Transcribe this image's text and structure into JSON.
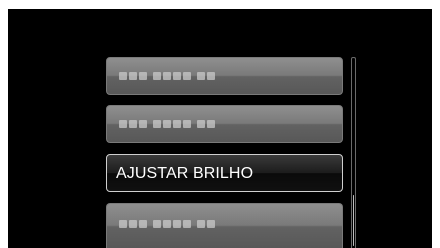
{
  "menu": {
    "items": [
      {
        "label": "",
        "state": "inactive",
        "content": "placeholder-blocks"
      },
      {
        "label": "",
        "state": "inactive",
        "content": "placeholder-blocks"
      },
      {
        "label": "AJUSTAR BRILHO",
        "state": "selected"
      },
      {
        "label": "",
        "state": "inactive",
        "content": "placeholder-blocks"
      }
    ],
    "selected_index": 2
  },
  "scrollbar": {
    "thumb_start_fraction": 0.72,
    "thumb_length_fraction": 0.27
  },
  "colors": {
    "screen_background": "#000000",
    "inactive_item": "#7a7a7a",
    "selected_item": "#1c1c1c",
    "selected_border": "#cfcfcf",
    "text": "#ffffff"
  }
}
